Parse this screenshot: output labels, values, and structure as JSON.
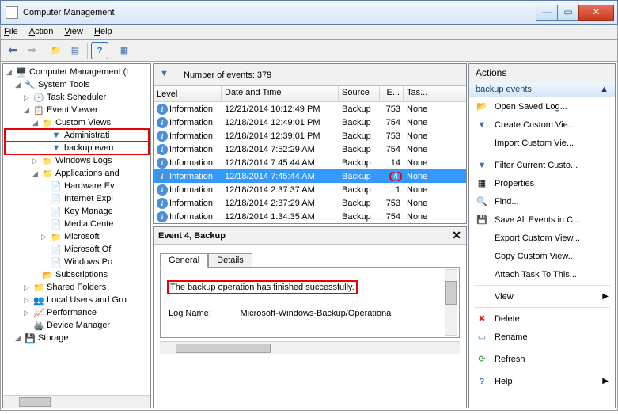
{
  "title": "Computer Management",
  "menu": {
    "file": "File",
    "action": "Action",
    "view": "View",
    "help": "Help"
  },
  "tree": {
    "root": "Computer Management (L",
    "systools": "System Tools",
    "tasksch": "Task Scheduler",
    "eventviewer": "Event Viewer",
    "custviews": "Custom Views",
    "admin": "Administrati",
    "backup": "backup even",
    "winlogs": "Windows Logs",
    "appsvc": "Applications and",
    "hw": "Hardware Ev",
    "ie": "Internet Expl",
    "km": "Key Manage",
    "mc": "Media Cente",
    "ms": "Microsoft",
    "msoff": "Microsoft Of",
    "winpo": "Windows Po",
    "subs": "Subscriptions",
    "shared": "Shared Folders",
    "local": "Local Users and Gro",
    "perf": "Performance",
    "devmgr": "Device Manager",
    "storage": "Storage"
  },
  "filter_label": "Number of events: 379",
  "cols": {
    "level": "Level",
    "date": "Date and Time",
    "source": "Source",
    "eid": "E...",
    "task": "Tas..."
  },
  "rows": [
    {
      "level": "Information",
      "date": "12/21/2014 10:12:49 PM",
      "source": "Backup",
      "eid": "753",
      "task": "None"
    },
    {
      "level": "Information",
      "date": "12/18/2014 12:49:01 PM",
      "source": "Backup",
      "eid": "754",
      "task": "None"
    },
    {
      "level": "Information",
      "date": "12/18/2014 12:39:01 PM",
      "source": "Backup",
      "eid": "753",
      "task": "None"
    },
    {
      "level": "Information",
      "date": "12/18/2014 7:52:29 AM",
      "source": "Backup",
      "eid": "754",
      "task": "None"
    },
    {
      "level": "Information",
      "date": "12/18/2014 7:45:44 AM",
      "source": "Backup",
      "eid": "14",
      "task": "None"
    },
    {
      "level": "Information",
      "date": "12/18/2014 7:45:44 AM",
      "source": "Backup",
      "eid": "4",
      "task": "None",
      "sel": true,
      "circ": true
    },
    {
      "level": "Information",
      "date": "12/18/2014 2:37:37 AM",
      "source": "Backup",
      "eid": "1",
      "task": "None"
    },
    {
      "level": "Information",
      "date": "12/18/2014 2:37:29 AM",
      "source": "Backup",
      "eid": "753",
      "task": "None"
    },
    {
      "level": "Information",
      "date": "12/18/2014 1:34:35 AM",
      "source": "Backup",
      "eid": "754",
      "task": "None"
    }
  ],
  "detail": {
    "title": "Event 4, Backup",
    "tab_general": "General",
    "tab_details": "Details",
    "message": "The backup operation has finished successfully.",
    "logname_label": "Log Name:",
    "logname_value": "Microsoft-Windows-Backup/Operational"
  },
  "actions": {
    "header": "Actions",
    "group": "backup events",
    "open": "Open Saved Log...",
    "create": "Create Custom Vie...",
    "import": "Import Custom Vie...",
    "filter": "Filter Current Custo...",
    "props": "Properties",
    "find": "Find...",
    "save": "Save All Events in C...",
    "export": "Export Custom View...",
    "copy": "Copy Custom View...",
    "attach": "Attach Task To This...",
    "view": "View",
    "delete": "Delete",
    "rename": "Rename",
    "refresh": "Refresh",
    "help": "Help"
  }
}
